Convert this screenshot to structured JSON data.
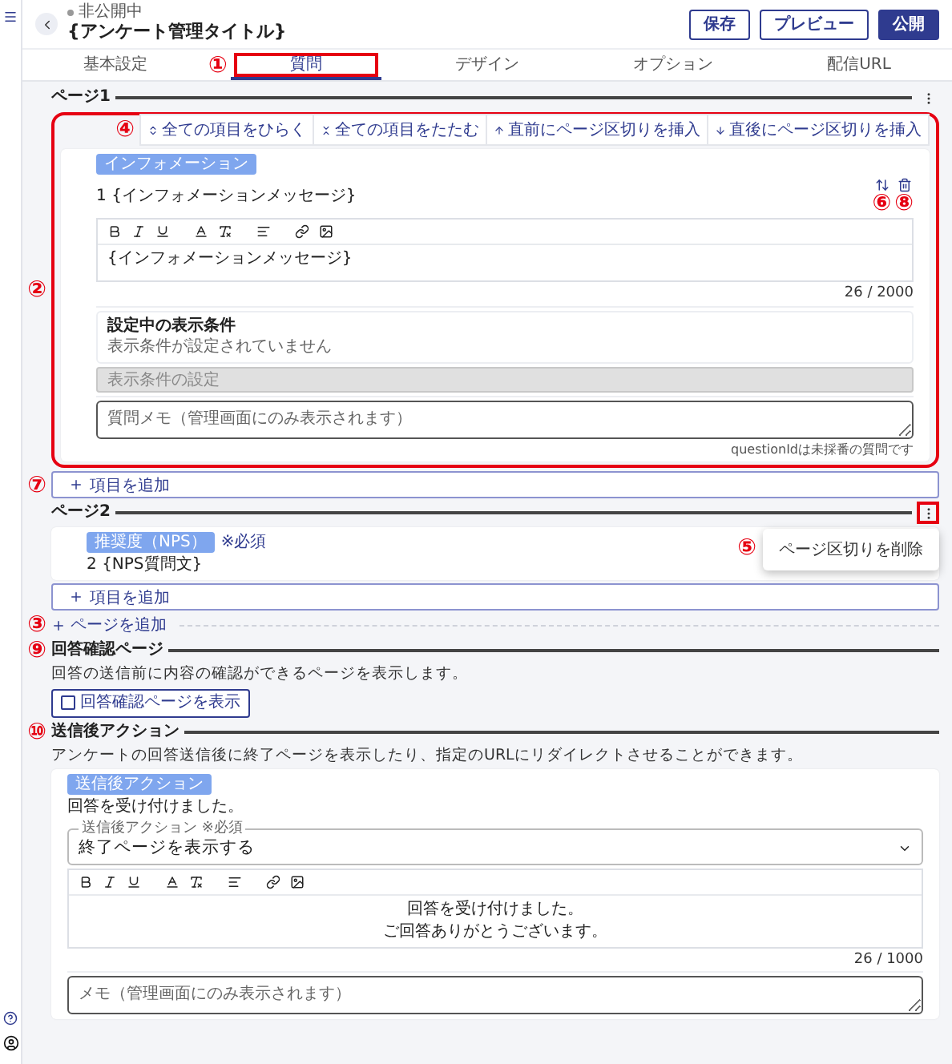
{
  "header": {
    "status": "非公開中",
    "title": "{アンケート管理タイトル}",
    "buttons": [
      {
        "label": "保存",
        "primary": false
      },
      {
        "label": "プレビュー",
        "primary": false
      },
      {
        "label": "公開",
        "primary": true
      }
    ]
  },
  "tabs": [
    {
      "label": "基本設定",
      "selected": false
    },
    {
      "label": "質問",
      "selected": true,
      "marker": "①"
    },
    {
      "label": "デザイン",
      "selected": false
    },
    {
      "label": "オプション",
      "selected": false
    },
    {
      "label": "配信URL",
      "selected": false
    }
  ],
  "pages": [
    {
      "title": "ページ1",
      "menu_open": false,
      "frame_marker": "②",
      "toolbar": {
        "marker": "④",
        "actions": [
          {
            "kind": "expand",
            "label": "全ての項目をひらく"
          },
          {
            "kind": "collapse",
            "label": "全ての項目をたたむ"
          },
          {
            "kind": "before",
            "label": "直前にページ区切りを挿入"
          },
          {
            "kind": "after",
            "label": "直後にページ区切りを挿入"
          }
        ]
      },
      "questions": [
        {
          "kind": "expanded",
          "badge": "インフォメーション",
          "number": "1",
          "title": "{インフォメーションメッセージ}",
          "sort_marker": "⑥",
          "delete_marker": "⑧",
          "body": "{インフォメーションメッセージ}",
          "count": "26 / 2000",
          "conditions": {
            "title": "設定中の表示条件",
            "text": "表示条件が設定されていません"
          },
          "condition_button": {
            "label": "表示条件の設定",
            "disabled": true
          },
          "memo_placeholder": "質問メモ（管理画面にのみ表示されます）",
          "footnote": "questionIdは未採番の質問です"
        }
      ],
      "add_item": {
        "label": "項目を追加",
        "marker": "⑦"
      }
    },
    {
      "title": "ページ2",
      "menu_open": true,
      "menu_marker": "⑤",
      "menu_items": [
        "ページ区切りを削除"
      ],
      "questions": [
        {
          "kind": "collapsed",
          "badge": "推奨度（NPS）",
          "required": "※必須",
          "number": "2",
          "title": "{NPS質問文}"
        }
      ],
      "add_item": {
        "label": "項目を追加"
      }
    }
  ],
  "add_page": {
    "label": "ページを追加",
    "marker": "③"
  },
  "confirm_section": {
    "marker": "⑨",
    "title": "回答確認ページ",
    "description": "回答の送信前に内容の確認ができるページを表示します。",
    "checkbox": {
      "label": "回答確認ページを表示",
      "checked": false
    }
  },
  "after_action": {
    "marker": "⑩",
    "title": "送信後アクション",
    "description": "アンケートの回答送信後に終了ページを表示したり、指定のURLにリダイレクトさせることができます。",
    "badge": "送信後アクション",
    "message": "回答を受け付けました。",
    "select": {
      "label": "送信後アクション ※必須",
      "value": "終了ページを表示する"
    },
    "body": [
      "回答を受け付けました。",
      "ご回答ありがとうございます。"
    ],
    "count": "26 / 1000",
    "memo_placeholder": "メモ（管理画面にのみ表示されます）"
  }
}
